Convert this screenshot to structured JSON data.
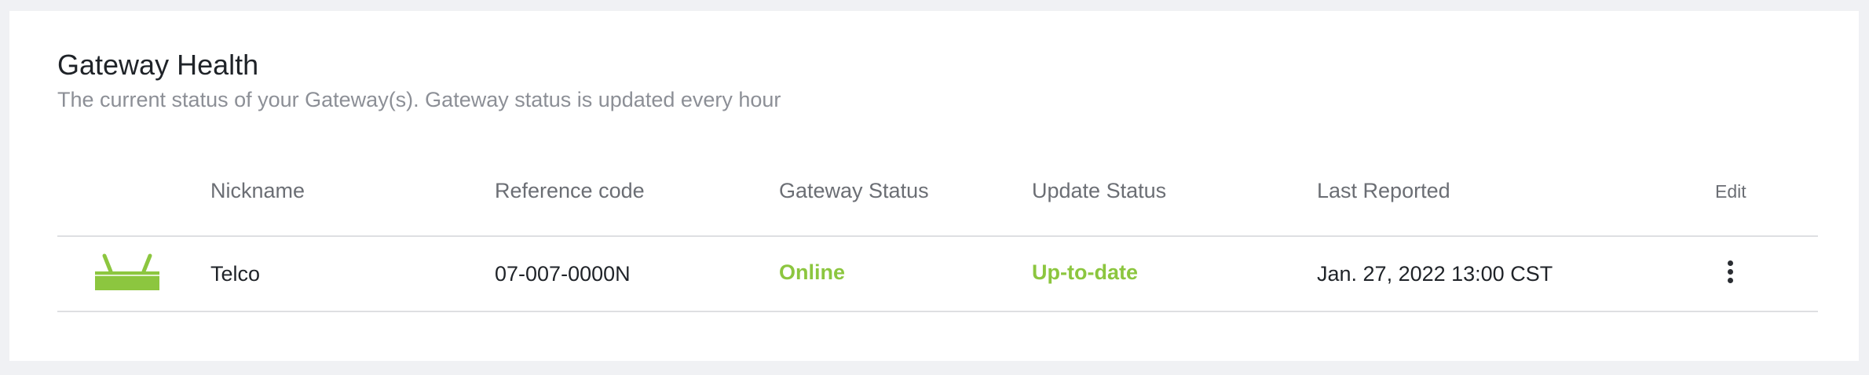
{
  "panel": {
    "title": "Gateway Health",
    "subtitle": "The current status of your Gateway(s). Gateway status is updated every hour"
  },
  "table": {
    "columns": [
      "Nickname",
      "Reference code",
      "Gateway Status",
      "Update Status",
      "Last Reported",
      "Edit"
    ],
    "rows": [
      {
        "icon": "router-icon",
        "nickname": "Telco",
        "reference_code": "07-007-0000N",
        "gateway_status": "Online",
        "update_status": "Up-to-date",
        "last_reported": "Jan. 27, 2022 13:00 CST",
        "action_icon": "more-vertical-icon"
      }
    ]
  },
  "colors": {
    "status_green": "#8cc63f",
    "background": "#f0f1f4",
    "card": "#ffffff"
  }
}
